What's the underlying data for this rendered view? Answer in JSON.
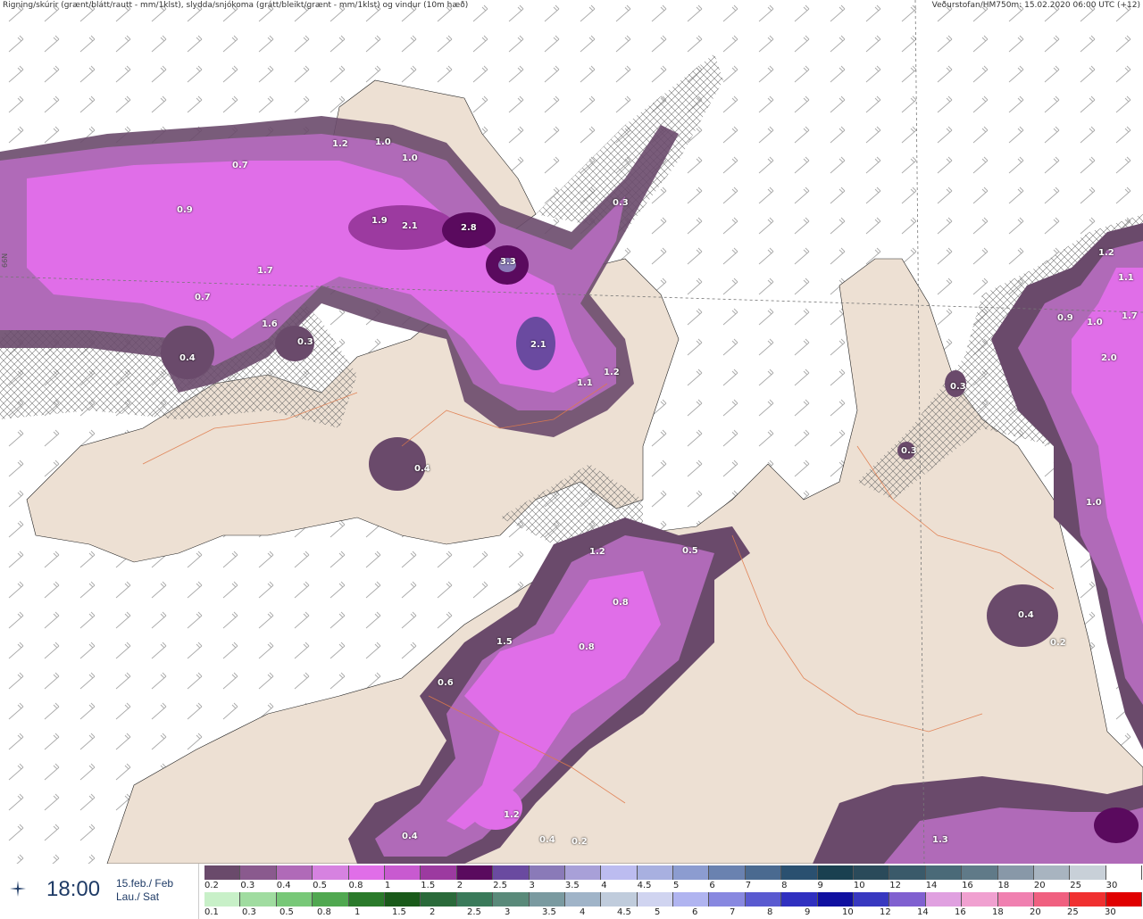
{
  "header": {
    "left": "Rigning/skúrir (grænt/blátt/rautt - mm/1klst), slydda/snjókoma (grátt/bleikt/grænt - mm/1klst) og vindur (10m hæð)",
    "right": "Veðurstofan/HM750m: 15.02.2020 06:00 UTC (+12)"
  },
  "lat_label": "66N",
  "footer": {
    "icon": "weather-star-icon",
    "time": "18:00",
    "date_line1": "15.feb./ Feb",
    "date_line2": "Lau./ Sat"
  },
  "colorscale_top": {
    "labels": [
      "0.2",
      "0.3",
      "0.4",
      "0.5",
      "0.8",
      "1",
      "1.5",
      "2",
      "2.5",
      "3",
      "3.5",
      "4",
      "4.5",
      "5",
      "6",
      "7",
      "8",
      "9",
      "10",
      "12",
      "14",
      "16",
      "18",
      "20",
      "25",
      "30"
    ],
    "colors": [
      "#6a4a6b",
      "#8a5a8e",
      "#b06ab8",
      "#d682e0",
      "#e06ee8",
      "#c85ad0",
      "#9c3aa0",
      "#5a0a5e",
      "#6a4aa0",
      "#8a7ab8",
      "#a8a0d8",
      "#bcbcf0",
      "#a8b0e0",
      "#8c9cd0",
      "#6a82b0",
      "#4a6a90",
      "#2a5070",
      "#1a4050",
      "#2a4a5a",
      "#3a5a6a",
      "#4a6a78",
      "#607a88",
      "#8898a8",
      "#a8b4c0",
      "#c8d0d8",
      "#ffffff"
    ]
  },
  "colorscale_bottom": {
    "labels": [
      "0.1",
      "0.3",
      "0.5",
      "0.8",
      "1",
      "1.5",
      "2",
      "2.5",
      "3",
      "3.5",
      "4",
      "4.5",
      "5",
      "6",
      "7",
      "8",
      "9",
      "10",
      "12",
      "14",
      "16",
      "18",
      "20",
      "25",
      "30"
    ],
    "colors": [
      "#c8f0c8",
      "#a0dca0",
      "#78c878",
      "#50a850",
      "#2a7a2a",
      "#1a5a1a",
      "#2a6a3a",
      "#3a7a5a",
      "#5a8a7a",
      "#7a9aa0",
      "#a0b4c8",
      "#c0ccdc",
      "#d0d4f0",
      "#b0b4f0",
      "#8888e0",
      "#5a5ad0",
      "#3030c0",
      "#1010a0",
      "#3838c0",
      "#8060d0",
      "#e0a0e0",
      "#f0a0d0",
      "#f080b0",
      "#f06080",
      "#f03030",
      "#e00000"
    ]
  },
  "map_values": [
    "1.2",
    "1.0",
    "1.0",
    "0.7",
    "0.9",
    "1.9",
    "2.1",
    "2.8",
    "3.3",
    "0.3",
    "1.7",
    "0.7",
    "1.6",
    "0.3",
    "0.4",
    "2.1",
    "1.2",
    "1.1",
    "0.4",
    "1.2",
    "0.5",
    "0.8",
    "0.8",
    "1.5",
    "0.6",
    "1.2",
    "0.4",
    "0.4",
    "0.2",
    "1.3",
    "0.3",
    "0.3",
    "1.2",
    "1.1",
    "0.9",
    "1.0",
    "1.7",
    "2.0",
    "1.0",
    "0.4",
    "0.2"
  ]
}
